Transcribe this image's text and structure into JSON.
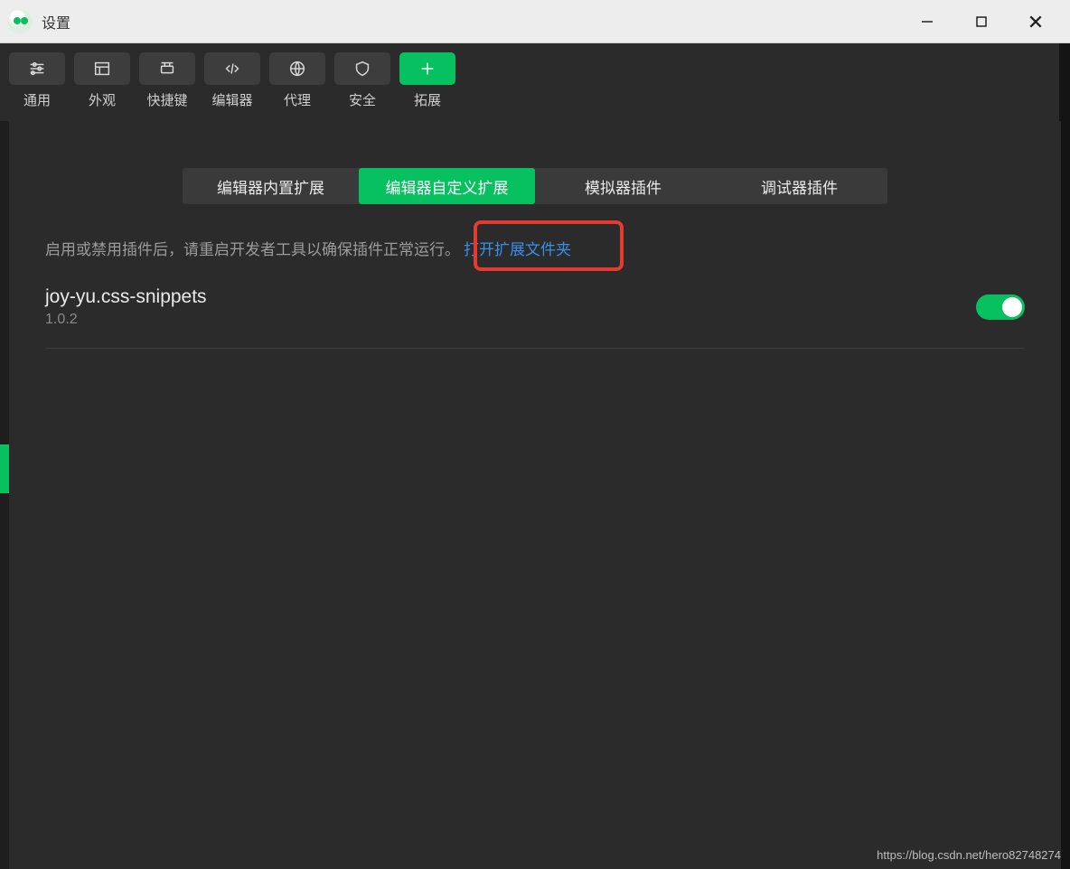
{
  "window": {
    "title": "设置"
  },
  "toolbar": {
    "items": [
      {
        "label": "通用"
      },
      {
        "label": "外观"
      },
      {
        "label": "快捷键"
      },
      {
        "label": "编辑器"
      },
      {
        "label": "代理"
      },
      {
        "label": "安全"
      },
      {
        "label": "拓展"
      }
    ]
  },
  "subtabs": {
    "items": [
      {
        "label": "编辑器内置扩展"
      },
      {
        "label": "编辑器自定义扩展"
      },
      {
        "label": "模拟器插件"
      },
      {
        "label": "调试器插件"
      }
    ],
    "active_index": 1
  },
  "hint": {
    "text": "启用或禁用插件后，请重启开发者工具以确保插件正常运行。",
    "link": "打开扩展文件夹"
  },
  "extensions": [
    {
      "name": "joy-yu.css-snippets",
      "version": "1.0.2",
      "enabled": true
    }
  ],
  "watermark": "https://blog.csdn.net/hero82748274"
}
